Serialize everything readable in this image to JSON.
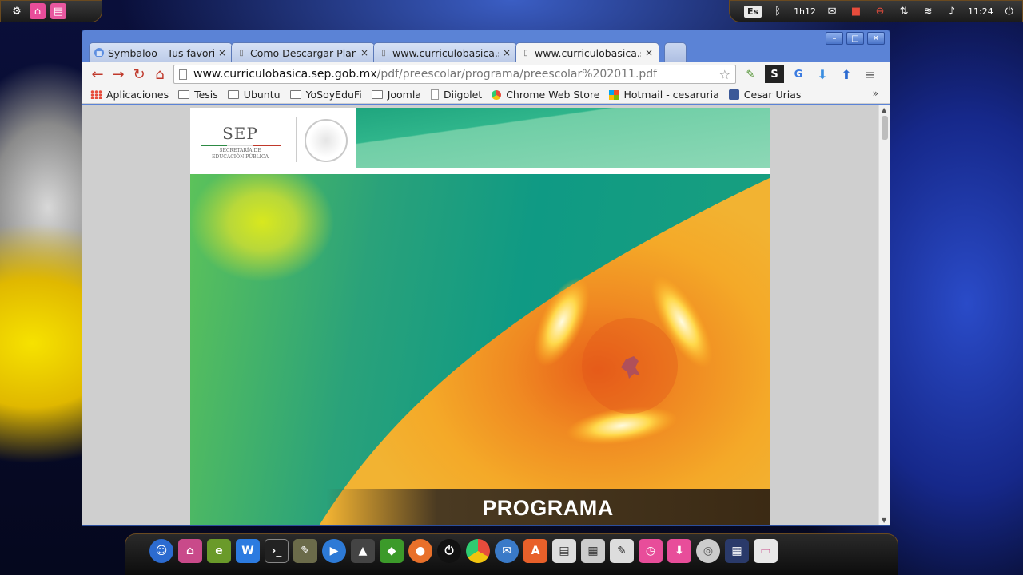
{
  "top_panel": {
    "lang": "Es",
    "battery": "1h12",
    "time": "11:24"
  },
  "browser": {
    "tabs": [
      {
        "title": "Symbaloo - Tus favorit",
        "icon": "symbaloo-icon"
      },
      {
        "title": "Como Descargar Plan",
        "icon": "page-icon"
      },
      {
        "title": "www.curriculobasica.s",
        "icon": "page-icon"
      },
      {
        "title": "www.curriculobasica.s",
        "icon": "page-icon",
        "active": true
      }
    ],
    "url_host": "www.curriculobasica.sep.gob.mx",
    "url_path": "/pdf/preescolar/programa/preescolar%202011.pdf",
    "bookmarks": [
      {
        "label": "Aplicaciones",
        "icon": "apps-icon"
      },
      {
        "label": "Tesis",
        "icon": "folder-icon"
      },
      {
        "label": "Ubuntu",
        "icon": "folder-icon"
      },
      {
        "label": "YoSoyEduFi",
        "icon": "folder-icon"
      },
      {
        "label": "Joomla",
        "icon": "folder-icon"
      },
      {
        "label": "Diigolet",
        "icon": "page-icon"
      },
      {
        "label": "Chrome Web Store",
        "icon": "chrome-web-store-icon"
      },
      {
        "label": "Hotmail - cesaruria",
        "icon": "windows-icon"
      },
      {
        "label": "Cesar Urias",
        "icon": "facebook-icon"
      }
    ],
    "bookmarks_more": "»"
  },
  "pdf": {
    "logo_title": "SEP",
    "logo_sub1": "SECRETARÍA DE",
    "logo_sub2": "EDUCACIÓN PÚBLICA",
    "cover_title": "PROGRAMA"
  },
  "colors": {
    "accent": "#e84d9a",
    "window": "#5b83d6"
  }
}
